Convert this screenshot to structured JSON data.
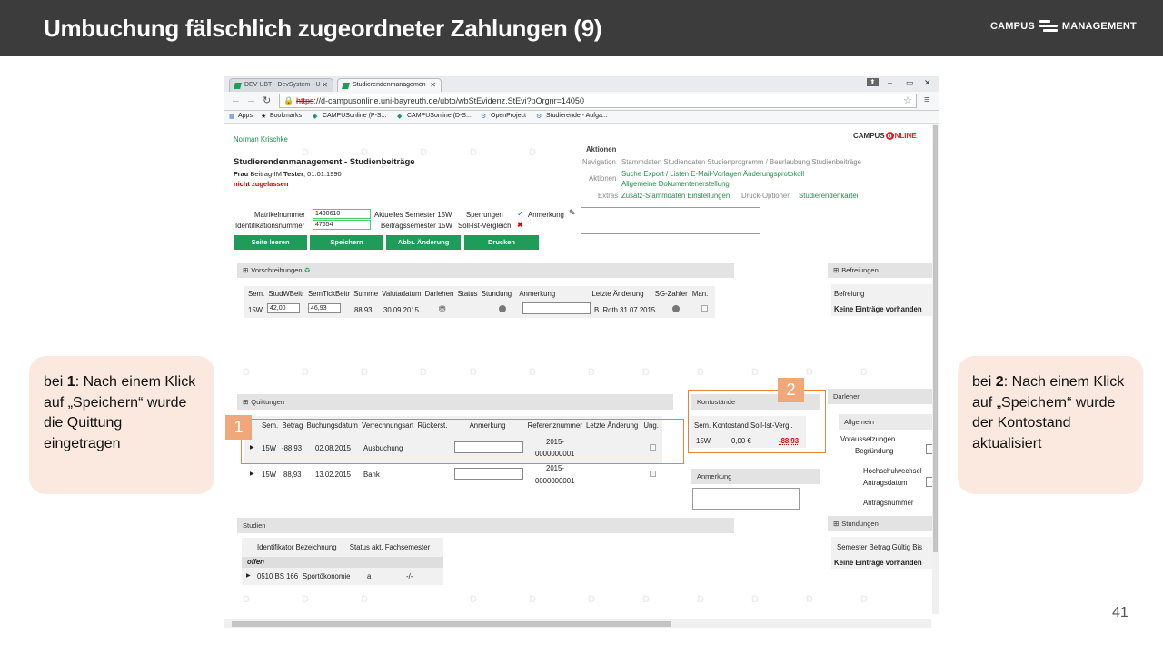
{
  "slide": {
    "title": "Umbuchung fälschlich zugeordneter Zahlungen (9)",
    "logo_left": "CAMPUS",
    "logo_right": "MANAGEMENT",
    "page_number": "41",
    "note_left": {
      "pre": "bei ",
      "num": "1",
      "text": ": Nach einem Klick auf „Speichern“ wurde die Quittung eingetragen"
    },
    "note_right": {
      "pre": "bei ",
      "num": "2",
      "text": ": Nach einem Klick auf „Speichern“ wurde der Kontostand aktualisiert"
    },
    "badge1": "1",
    "badge2": "2"
  },
  "browser": {
    "tab1": "DEV UBT - DevSystem - U",
    "tab2": "Studierendenmanagemen",
    "url_https": "https",
    "url_rest": "://d-campusonline.uni-bayreuth.de/ubto/wbStEvidenz.StEvi?pOrgnr=14050",
    "bookmarks": [
      "Apps",
      "Bookmarks",
      "CAMPUSonline (P-S...",
      "CAMPUSonline (D-S...",
      "OpenProject",
      "Studierende - Aufga..."
    ]
  },
  "app": {
    "user": "Norman Krischke",
    "brand_campus": "CAMPUS",
    "brand_online": "NLINE",
    "heading": "Studierendenmanagement - Studienbeiträge",
    "salutation": "Frau",
    "person": "Beitrag-IM",
    "lastname": "Tester",
    "birth": ", 01.01.1990",
    "status": "nicht zugelassen",
    "aktionen_title": "Aktionen",
    "nav_label": "Navigation",
    "nav_links": "Stammdaten  Studiendaten  Studienprogramm / Beurlaubung  Studienbeiträge",
    "akt_label": "Aktionen",
    "akt_links1": "Suche  Export / Listen  E-Mail-Vorlagen  Änderungsprotokoll",
    "akt_links2": "Allgemeine Dokumentenerstellung",
    "extras_label": "Extras",
    "extras_links": "Zusatz-Stammdaten  Einstellungen",
    "extras_grey": "Druck-Optionen",
    "extras_last": "Studierendenkartei",
    "matrikel_label": "Matrikelnummer",
    "matrikel_value": "1400610",
    "ident_label": "Identifikationsnummer",
    "ident_value": "47654",
    "akt_sem": "Aktuelles Semester  15W",
    "beitr_sem": "Beitragssemester  15W",
    "sperr": "Sperrungen",
    "sollist": "Soll-Ist-Vergleich",
    "anmerkung": "Anmerkung",
    "buttons": [
      "Seite leeren",
      "Speichern",
      "Abbr. Änderung",
      "Drucken"
    ],
    "vorschreibungen": {
      "title": "Vorschreibungen",
      "headers": [
        "Sem.",
        "StudWBeitr",
        "SemTickBeitr",
        "Summe",
        "Valutadatum",
        "Darlehen",
        "Status",
        "Stundung",
        "Anmerkung",
        "Letzte Änderung",
        "SG-Zahler",
        "Man."
      ],
      "row": {
        "sem": "15W",
        "stud": "42,00",
        "tick": "46,93",
        "sum": "88,93",
        "date": "30.09.2015",
        "last": "B. Roth 31.07.2015"
      }
    },
    "befreiungen": {
      "title": "Befreiungen",
      "sub": "Befreiung",
      "empty": "Keine Einträge vorhanden"
    },
    "quittungen": {
      "title": "Quittungen",
      "headers": [
        "Sem.",
        "Betrag",
        "Buchungsdatum",
        "Verrechnungsart",
        "Rückerst.",
        "Anmerkung",
        "Referenznummer",
        "Letzte Änderung",
        "Ung."
      ],
      "rows": [
        {
          "sem": "15W",
          "betrag": "-88,93",
          "date": "02.08.2015",
          "art": "Ausbuchung",
          "ref1": "2015-",
          "ref2": "0000000001"
        },
        {
          "sem": "15W",
          "betrag": "88,93",
          "date": "13.02.2015",
          "art": "Bank",
          "ref1": "2015-",
          "ref2": "0000000001"
        }
      ]
    },
    "konto": {
      "title": "Kontostände",
      "headers": [
        "Sem.",
        "Kontostand",
        "Soll-Ist-Vergl."
      ],
      "sem": "15W",
      "stand": "0,00 €",
      "diff": "-88,93"
    },
    "anmerkung_box": "Anmerkung",
    "darlehen": {
      "title": "Darlehen",
      "sub": "Allgemein",
      "fields": [
        "Voraussetzungen",
        "Begründung",
        "Hochschulwechsel",
        "Antragsdatum",
        "Antragsnummer"
      ]
    },
    "studien": {
      "title": "Studien",
      "headers": [
        "Identifikator",
        "Bezeichnung",
        "Status",
        "akt. Fachsemester"
      ],
      "group": "offen",
      "row": {
        "id": "0510 BS 166",
        "name": "Sportökonomie",
        "status": "a",
        "sem": "-/-"
      }
    },
    "stundungen": {
      "title": "Stundungen",
      "headers": "Semester  Betrag  Gültig Bis",
      "empty": "Keine Einträge vorhanden"
    }
  }
}
